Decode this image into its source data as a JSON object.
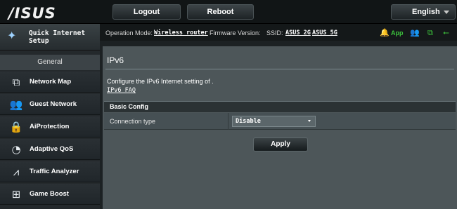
{
  "header": {
    "logo": "/ISUS",
    "logout_label": "Logout",
    "reboot_label": "Reboot",
    "language": "English"
  },
  "sidebar": {
    "quick_setup": "Quick Internet Setup",
    "section_general": "General",
    "items": [
      {
        "label": "Network Map",
        "icon": "network-map-icon"
      },
      {
        "label": "Guest Network",
        "icon": "guest-network-icon"
      },
      {
        "label": "AiProtection",
        "icon": "lock-icon"
      },
      {
        "label": "Adaptive QoS",
        "icon": "speedometer-icon"
      },
      {
        "label": "Traffic Analyzer",
        "icon": "traffic-analyzer-icon"
      },
      {
        "label": "Game Boost",
        "icon": "gamepad-icon"
      }
    ]
  },
  "status": {
    "operation_mode_label": "Operation Mode:",
    "operation_mode_value": "Wireless router",
    "firmware_label": "Firmware Version:",
    "ssid_label": "SSID:",
    "ssid_2g": "ASUS_2G",
    "ssid_5g": "ASUS_5G",
    "app_label": "App",
    "icons": [
      "notification-bell-icon",
      "app-icon",
      "users-icon",
      "copy-icon",
      "usb-icon"
    ],
    "accent": "#3cc23c"
  },
  "main": {
    "title": "IPv6",
    "description": "Configure the IPv6 Internet setting of .",
    "faq_link": "IPv6 FAQ",
    "section_title": "Basic Config",
    "connection_type_label": "Connection type",
    "connection_type_value": "Disable",
    "apply_label": "Apply"
  }
}
